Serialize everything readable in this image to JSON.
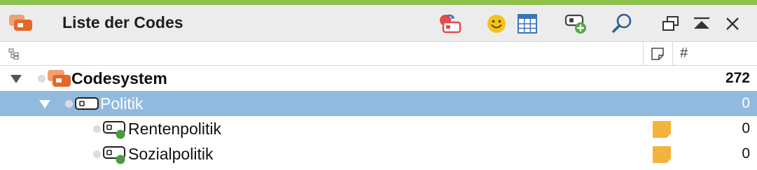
{
  "window": {
    "title": "Liste der Codes",
    "accent_color": "#8dc04a",
    "toolbar_icons": [
      "code-set-icon",
      "emoticode-icon",
      "table-grid-icon",
      "new-code-icon",
      "search-icon",
      "undock-window-icon",
      "collapse-panel-icon",
      "close-icon"
    ]
  },
  "columns": {
    "tree_icon": "hierarchy-icon",
    "memo_icon": "memo-icon",
    "count_symbol": "#"
  },
  "codes": [
    {
      "label": "Codesystem",
      "count": "272",
      "level": 0,
      "bold": true,
      "expanded": true,
      "selected": false,
      "type": "codesystem"
    },
    {
      "label": "Politik",
      "count": "0",
      "level": 1,
      "bold": false,
      "expanded": true,
      "selected": true,
      "type": "code",
      "color": "#ffffff"
    },
    {
      "label": "Rentenpolitik",
      "count": "0",
      "level": 2,
      "bold": false,
      "selected": false,
      "type": "code",
      "color": "#4a9b3e",
      "memo": true
    },
    {
      "label": "Sozialpolitik",
      "count": "0",
      "level": 2,
      "bold": false,
      "selected": false,
      "type": "code",
      "color": "#4a9b3e",
      "memo": true
    }
  ],
  "colors": {
    "selection": "#91bade",
    "memo": "#f2b43c",
    "code_orange": "#e5672a",
    "code_green": "#4a9b3e"
  }
}
